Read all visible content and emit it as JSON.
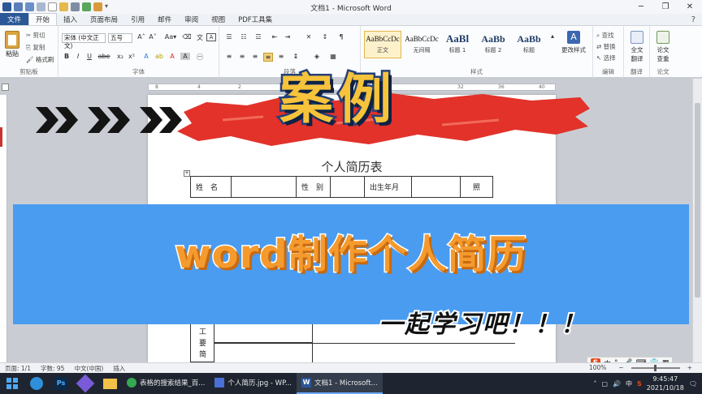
{
  "window": {
    "title": "文档1 - Microsoft Word"
  },
  "tabs": [
    "文件",
    "开始",
    "插入",
    "页面布局",
    "引用",
    "邮件",
    "审阅",
    "视图",
    "PDF工具集"
  ],
  "ribbon": {
    "clipboard": {
      "paste": "粘贴",
      "cut": "剪切",
      "copy": "复制",
      "format_painter": "格式刷",
      "label": "剪贴板"
    },
    "font": {
      "font_name": "宋体 (中文正文)",
      "font_size": "五号",
      "label": "字体",
      "bold": "B",
      "italic": "I",
      "underline": "U",
      "strike": "abe"
    },
    "paragraph": {
      "label": "段落"
    },
    "styles": {
      "label": "样式",
      "items": [
        {
          "preview": "AaBbCcDc",
          "name": "正文"
        },
        {
          "preview": "AaBbCcDc",
          "name": "无间隔"
        },
        {
          "preview": "AaBl",
          "name": "标题 1"
        },
        {
          "preview": "AaBb",
          "name": "标题 2"
        },
        {
          "preview": "AaBb",
          "name": "标题"
        }
      ],
      "change_styles": "更改样式"
    },
    "editing": {
      "find": "查找",
      "replace": "替换",
      "select": "选择",
      "label": "编辑"
    },
    "translate": {
      "full_text": "全文\n翻译",
      "label": "翻译"
    },
    "paper": {
      "check": "论文\n查重",
      "label": "论文"
    }
  },
  "document": {
    "title": "个人简历表",
    "table": {
      "row1": [
        "姓　名",
        "",
        "性　别",
        "",
        "出生年月",
        "",
        "照"
      ],
      "side_labels": [
        "工",
        "要",
        "简"
      ]
    }
  },
  "overlay": {
    "main_title": "案例",
    "banner_title": "word制作个人简历",
    "slogan": "一起学习吧！！！"
  },
  "statusbar": {
    "page": "页面: 1/1",
    "words": "字数: 95",
    "language": "中文(中国)",
    "mode": "插入",
    "zoom": "100%"
  },
  "ime": {
    "mode": "中"
  },
  "taskbar": {
    "apps": [
      {
        "label": "表格的搜索结果_百..."
      },
      {
        "label": "个人简历.jpg - WP..."
      },
      {
        "label": "文档1 - Microsoft..."
      }
    ],
    "time": "9:45:47",
    "date": "2021/10/18",
    "ime": "中"
  },
  "colors": {
    "word_blue": "#2b5797",
    "banner_blue": "#4a9cf0",
    "title_yellow": "#f6c33b",
    "brush_red": "#e2322a",
    "banner_orange": "#f59a2d"
  }
}
